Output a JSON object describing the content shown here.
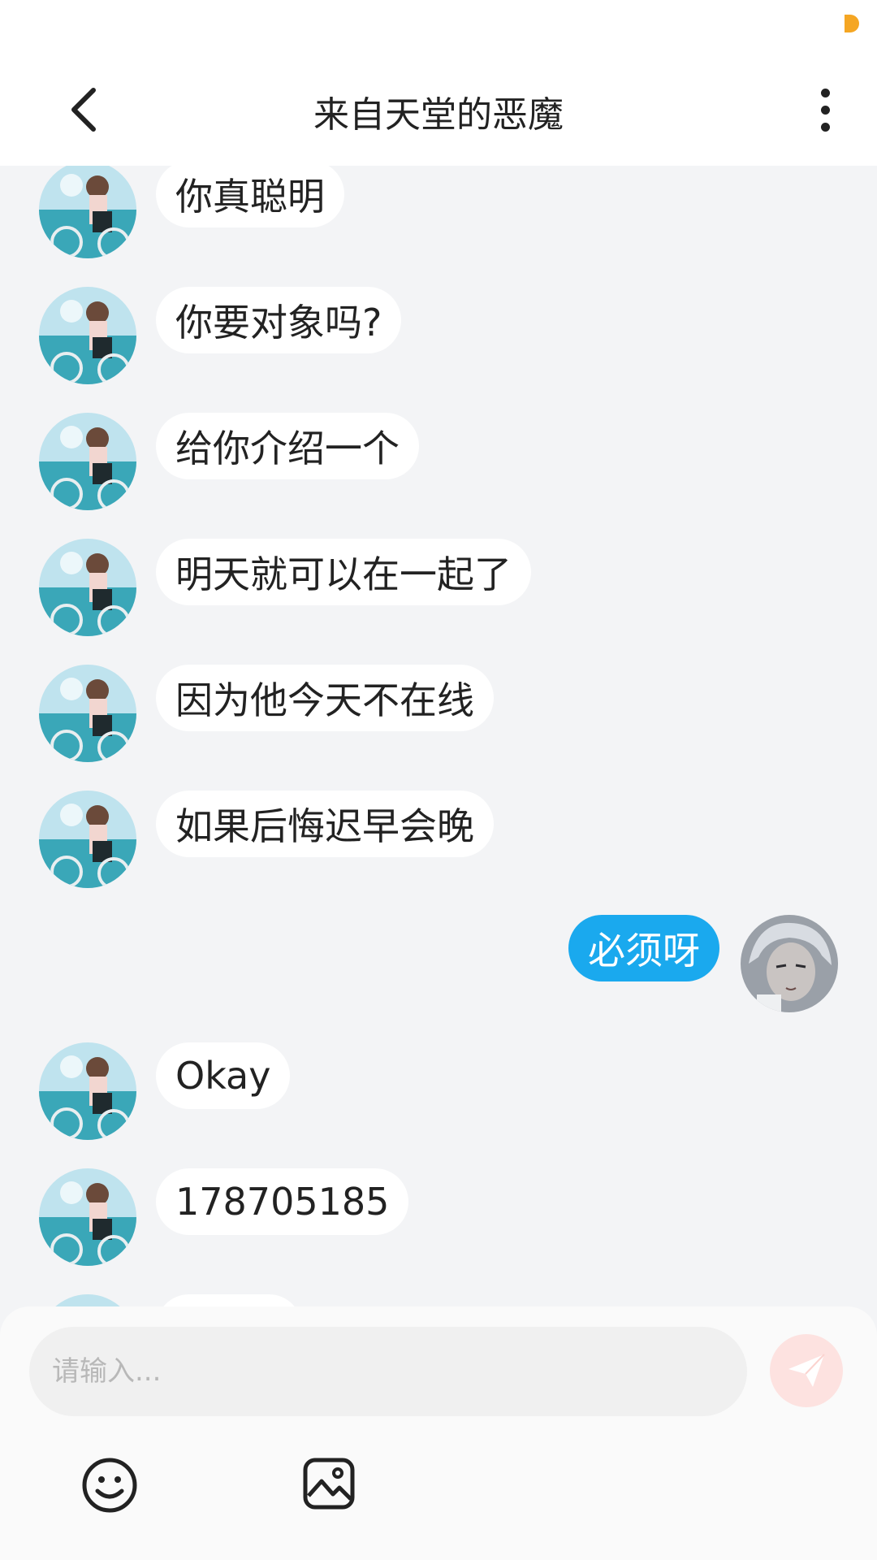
{
  "header": {
    "title": "来自天堂的恶魔"
  },
  "icons": {
    "back": "chevron-left-icon",
    "more": "more-vertical-icon",
    "send": "paper-plane-icon",
    "emoji": "smiley-face-icon",
    "image": "image-icon"
  },
  "messages": [
    {
      "side": "in",
      "text": "你真聪明"
    },
    {
      "side": "in",
      "text": "你要对象吗?"
    },
    {
      "side": "in",
      "text": "给你介绍一个"
    },
    {
      "side": "in",
      "text": "明天就可以在一起了"
    },
    {
      "side": "in",
      "text": "因为他今天不在线"
    },
    {
      "side": "in",
      "text": "如果后悔迟早会晚"
    },
    {
      "side": "out",
      "text": "必须呀"
    },
    {
      "side": "in",
      "text": "Okay"
    },
    {
      "side": "in",
      "text": "178705185"
    }
  ],
  "composer": {
    "placeholder": "请输入..."
  },
  "colors": {
    "outgoing_bubble": "#1aa9ee",
    "incoming_bubble": "#ffffff",
    "link_text": "#2a6fa8",
    "send_button_bg": "#fde2e0",
    "status_dot": "#f5a623"
  }
}
